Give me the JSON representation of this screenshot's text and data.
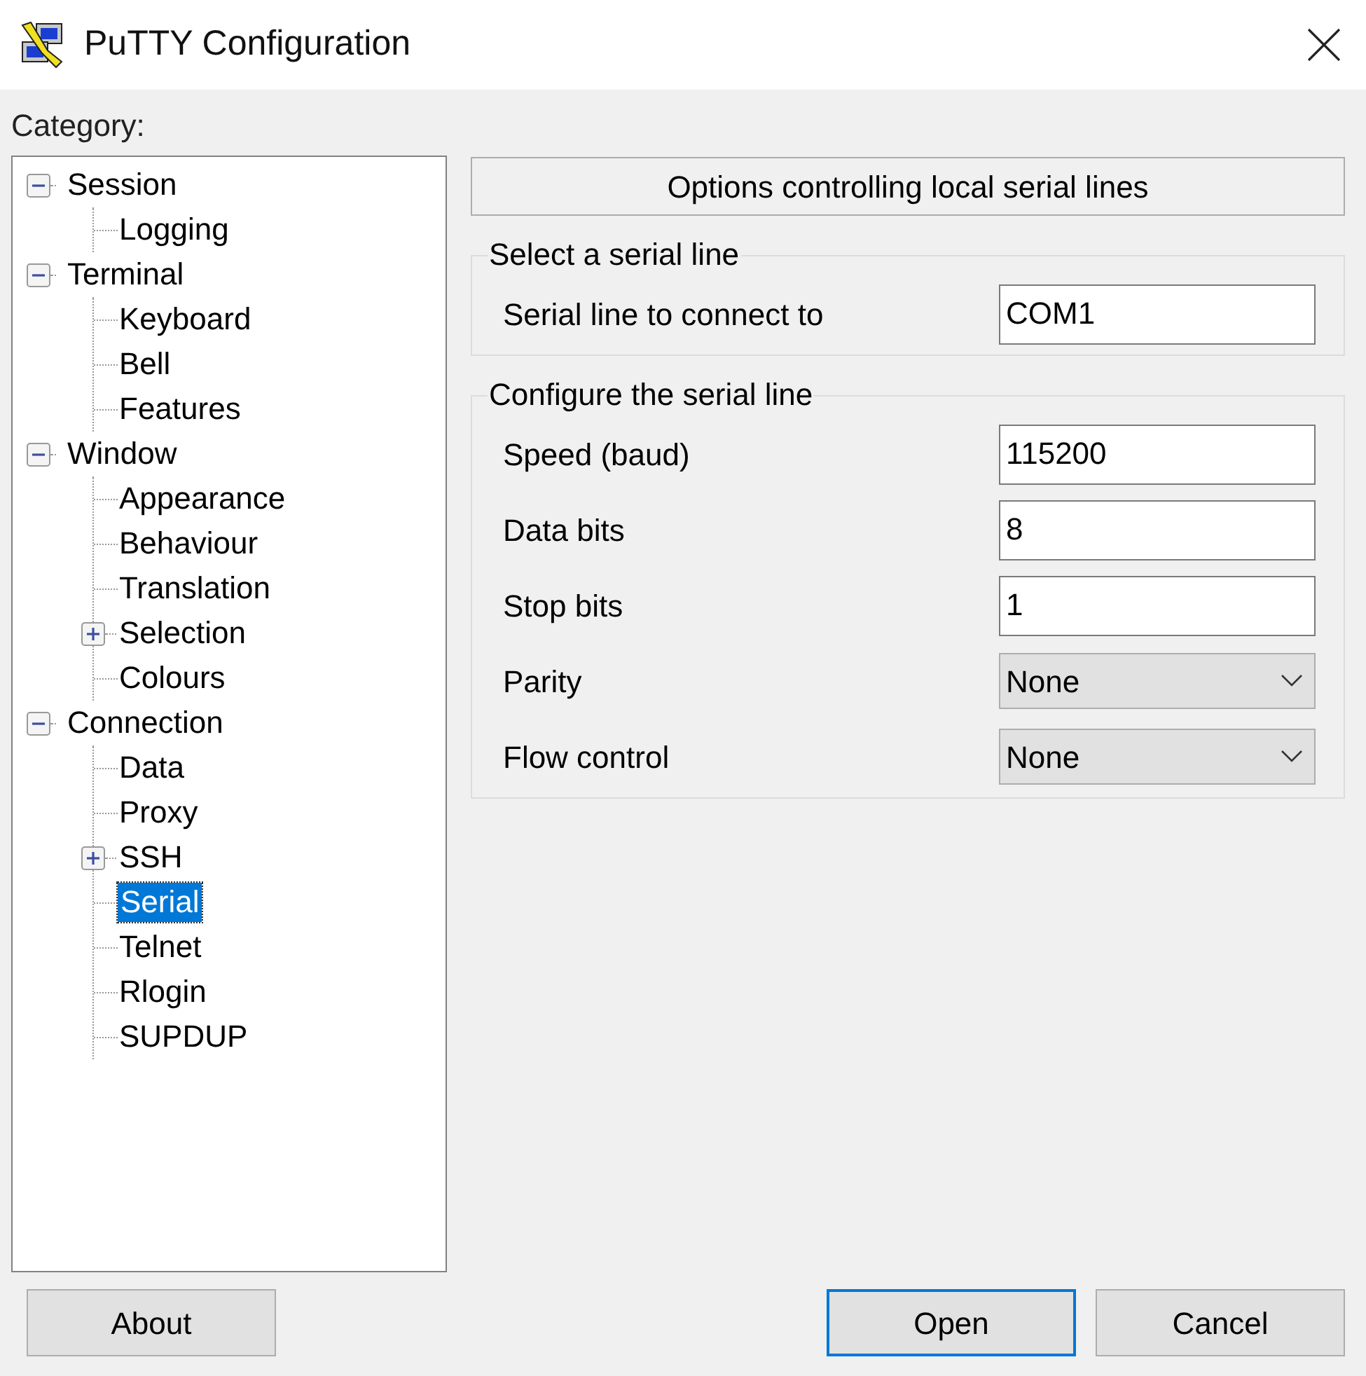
{
  "window": {
    "title": "PuTTY Configuration"
  },
  "category_label": "Category:",
  "tree": [
    {
      "label": "Session",
      "expanded": true,
      "selected": false,
      "children": [
        {
          "label": "Logging",
          "selected": false
        }
      ]
    },
    {
      "label": "Terminal",
      "expanded": true,
      "selected": false,
      "children": [
        {
          "label": "Keyboard",
          "selected": false
        },
        {
          "label": "Bell",
          "selected": false
        },
        {
          "label": "Features",
          "selected": false
        }
      ]
    },
    {
      "label": "Window",
      "expanded": true,
      "selected": false,
      "children": [
        {
          "label": "Appearance",
          "selected": false
        },
        {
          "label": "Behaviour",
          "selected": false
        },
        {
          "label": "Translation",
          "selected": false
        },
        {
          "label": "Selection",
          "expanded": false,
          "selected": false
        },
        {
          "label": "Colours",
          "selected": false
        }
      ]
    },
    {
      "label": "Connection",
      "expanded": true,
      "selected": false,
      "children": [
        {
          "label": "Data",
          "selected": false
        },
        {
          "label": "Proxy",
          "selected": false
        },
        {
          "label": "SSH",
          "expanded": false,
          "selected": false
        },
        {
          "label": "Serial",
          "selected": true
        },
        {
          "label": "Telnet",
          "selected": false
        },
        {
          "label": "Rlogin",
          "selected": false
        },
        {
          "label": "SUPDUP",
          "selected": false
        }
      ]
    }
  ],
  "panel_header": "Options controlling local serial lines",
  "groups": [
    {
      "title": "Select a serial line",
      "fields": [
        {
          "kind": "text",
          "label": "Serial line to connect to",
          "value": "COM1"
        }
      ]
    },
    {
      "title": "Configure the serial line",
      "fields": [
        {
          "kind": "text",
          "label": "Speed (baud)",
          "value": "115200"
        },
        {
          "kind": "text",
          "label": "Data bits",
          "value": "8"
        },
        {
          "kind": "text",
          "label": "Stop bits",
          "value": "1"
        },
        {
          "kind": "select",
          "label": "Parity",
          "value": "None"
        },
        {
          "kind": "select",
          "label": "Flow control",
          "value": "None"
        }
      ]
    }
  ],
  "buttons": [
    {
      "label": "About",
      "default": false
    },
    {
      "label": "Open",
      "default": true
    },
    {
      "label": "Cancel",
      "default": false
    }
  ]
}
